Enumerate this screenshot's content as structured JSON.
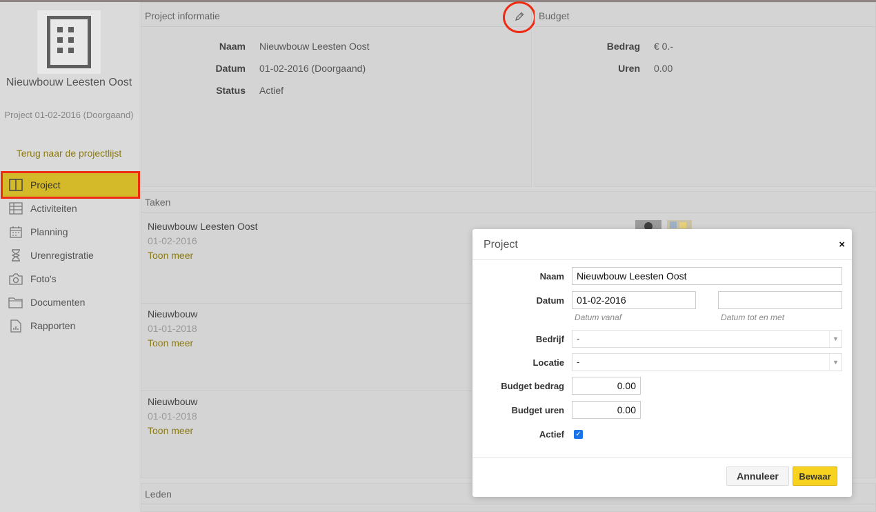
{
  "sidebar": {
    "project_name": "Nieuwbouw Leesten Oost",
    "project_sub": "Project 01-02-2016 (Doorgaand)",
    "back_link": "Terug naar de projectlijst",
    "nav": [
      {
        "label": "Project",
        "icon": "columns-icon",
        "active": true
      },
      {
        "label": "Activiteiten",
        "icon": "table-icon"
      },
      {
        "label": "Planning",
        "icon": "calendar-icon"
      },
      {
        "label": "Urenregistratie",
        "icon": "hourglass-icon"
      },
      {
        "label": "Foto's",
        "icon": "camera-icon"
      },
      {
        "label": "Documenten",
        "icon": "folder-icon"
      },
      {
        "label": "Rapporten",
        "icon": "report-icon"
      }
    ]
  },
  "info": {
    "title": "Project informatie",
    "rows": [
      {
        "label": "Naam",
        "value": "Nieuwbouw Leesten Oost"
      },
      {
        "label": "Datum",
        "value": "01-02-2016 (Doorgaand)"
      },
      {
        "label": "Status",
        "value": "Actief"
      }
    ]
  },
  "budget": {
    "title": "Budget",
    "rows": [
      {
        "label": "Bedrag",
        "value": "€ 0.-"
      },
      {
        "label": "Uren",
        "value": "0.00"
      }
    ]
  },
  "tasks": {
    "title": "Taken",
    "items": [
      {
        "title": "Nieuwbouw Leesten Oost",
        "date": "01-02-2016",
        "more": "Toon meer"
      },
      {
        "title": "Nieuwbouw",
        "date": "01-01-2018",
        "more": "Toon meer"
      },
      {
        "title": "Nieuwbouw",
        "date": "01-01-2018",
        "more": "Toon meer"
      }
    ]
  },
  "members": {
    "title": "Leden"
  },
  "modal": {
    "title": "Project",
    "close": "×",
    "fields": {
      "naam_label": "Naam",
      "naam_value": "Nieuwbouw Leesten Oost",
      "datum_label": "Datum",
      "datum_from_value": "01-02-2016",
      "datum_to_value": "",
      "datum_from_hint": "Datum vanaf",
      "datum_to_hint": "Datum tot en met",
      "bedrijf_label": "Bedrijf",
      "bedrijf_value": "-",
      "locatie_label": "Locatie",
      "locatie_value": "-",
      "budget_bedrag_label": "Budget bedrag",
      "budget_bedrag_value": "0.00",
      "budget_uren_label": "Budget uren",
      "budget_uren_value": "0.00",
      "actief_label": "Actief",
      "actief_checked": true
    },
    "cancel": "Annuleer",
    "save": "Bewaar"
  },
  "colors": {
    "accent": "#d4b928",
    "link": "#8c7a10",
    "highlight_red": "#ef2a12",
    "save_button": "#f7d21e",
    "checkbox": "#1a73e8"
  }
}
